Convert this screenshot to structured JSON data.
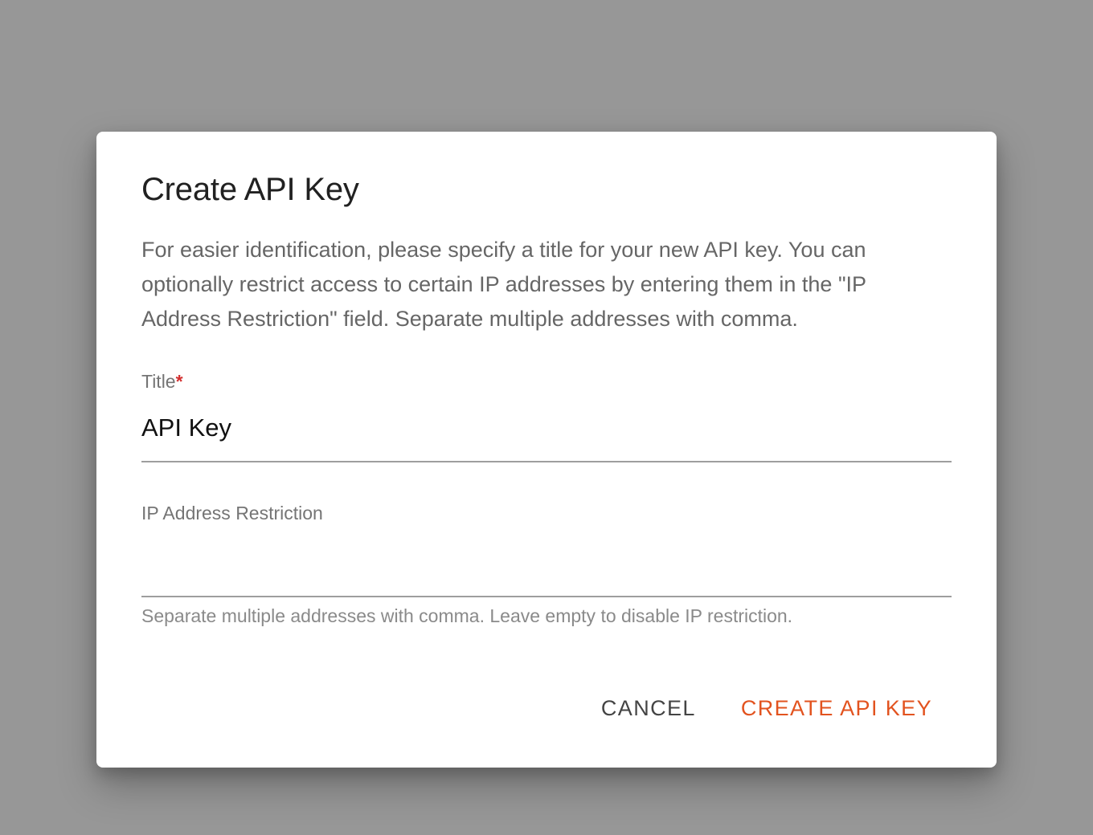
{
  "dialog": {
    "title": "Create API Key",
    "description": "For easier identification, please specify a title for your new API key. You can optionally restrict access to certain IP addresses by entering them in the \"IP Address Restriction\" field. Separate multiple addresses with comma."
  },
  "fields": {
    "title": {
      "label": "Title",
      "required_mark": "*",
      "value": "API Key"
    },
    "ip_restriction": {
      "label": "IP Address Restriction",
      "value": "",
      "helper": "Separate multiple addresses with comma. Leave empty to disable IP restriction."
    }
  },
  "actions": {
    "cancel_label": "CANCEL",
    "create_label": "CREATE API KEY"
  },
  "colors": {
    "backdrop": "#979797",
    "accent": "#e2531f",
    "required": "#d32f2f"
  }
}
